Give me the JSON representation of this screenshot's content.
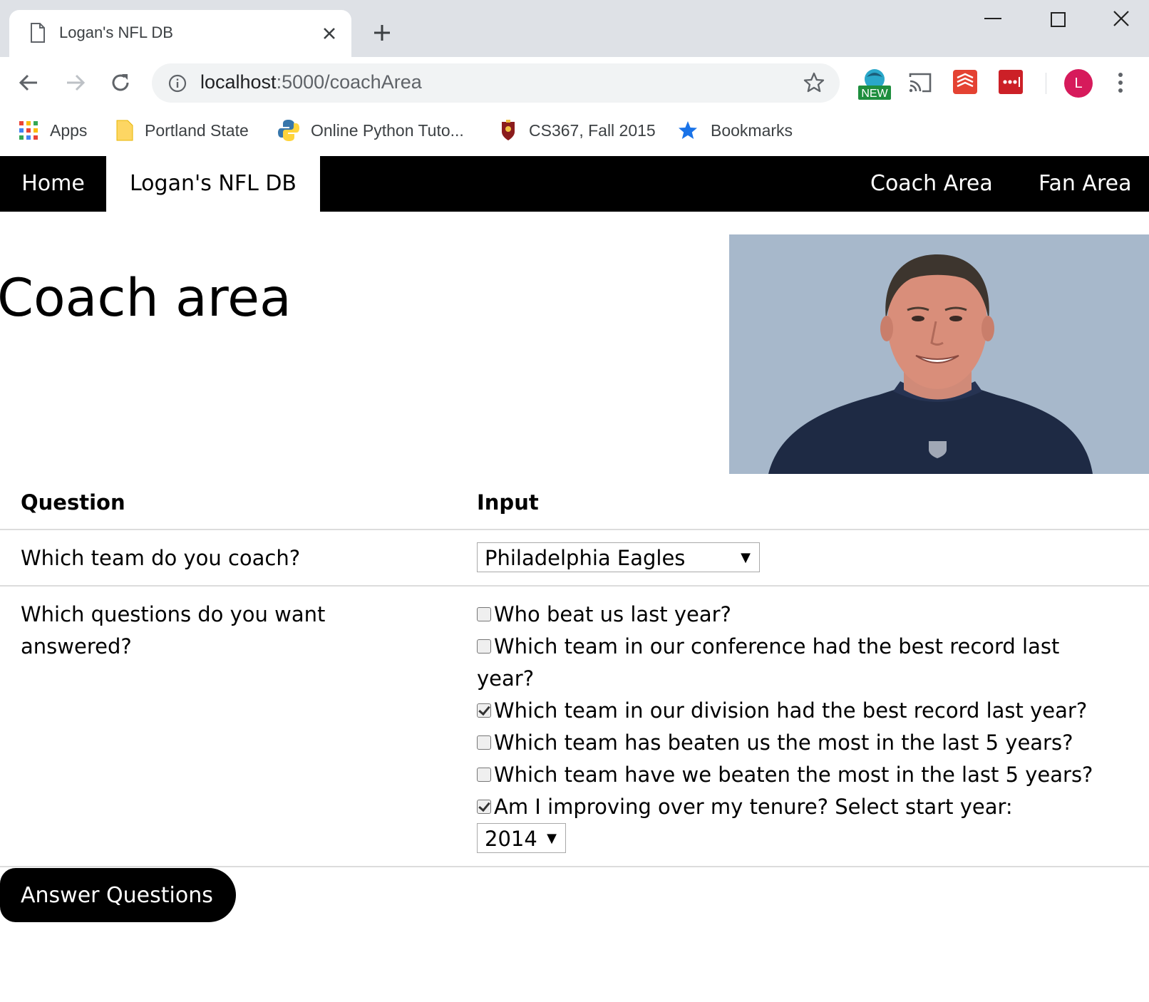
{
  "browser": {
    "tab_title": "Logan's NFL DB",
    "url_host": "localhost",
    "url_path": ":5000/coachArea",
    "new_badge": "NEW",
    "avatar_letter": "L",
    "bookmarks": [
      {
        "label": "Apps",
        "icon": "apps-grid-icon"
      },
      {
        "label": "Portland State",
        "icon": "folder-icon"
      },
      {
        "label": "Online Python Tuto...",
        "icon": "python-icon"
      },
      {
        "label": "CS367, Fall 2015",
        "icon": "shield-crest-icon"
      },
      {
        "label": "Bookmarks",
        "icon": "star-icon"
      }
    ]
  },
  "nav": {
    "home": "Home",
    "brand": "Logan's NFL DB",
    "coach": "Coach Area",
    "fan": "Fan Area"
  },
  "page": {
    "title": "Coach area",
    "image_icon": "coach-portrait"
  },
  "table": {
    "header_question": "Question",
    "header_input": "Input",
    "q1": "Which team do you coach?",
    "q1_value": "Philadelphia Eagles",
    "q2_line1": "Which questions do you want",
    "q2_line2": "answered?",
    "options": [
      {
        "line1": "Who beat us last year?",
        "checked": false
      },
      {
        "line1": "Which team in our conference had the best record last",
        "line2": "year?",
        "checked": false
      },
      {
        "line1": "Which team in our division had the best record last year?",
        "checked": true
      },
      {
        "line1": "Which team has beaten us the most in the last 5 years?",
        "checked": false
      },
      {
        "line1": "Which team have we beaten the most in the last 5 years?",
        "checked": false
      },
      {
        "line1": "Am I improving over my tenure? Select start year:",
        "checked": true
      }
    ],
    "start_year": "2014"
  },
  "submit_label": "Answer Questions",
  "colors": {
    "nav_bg": "#000000",
    "avatar": "#d61a5b",
    "ext_green": "#1e8e3e",
    "ext_red": "#db4437"
  }
}
